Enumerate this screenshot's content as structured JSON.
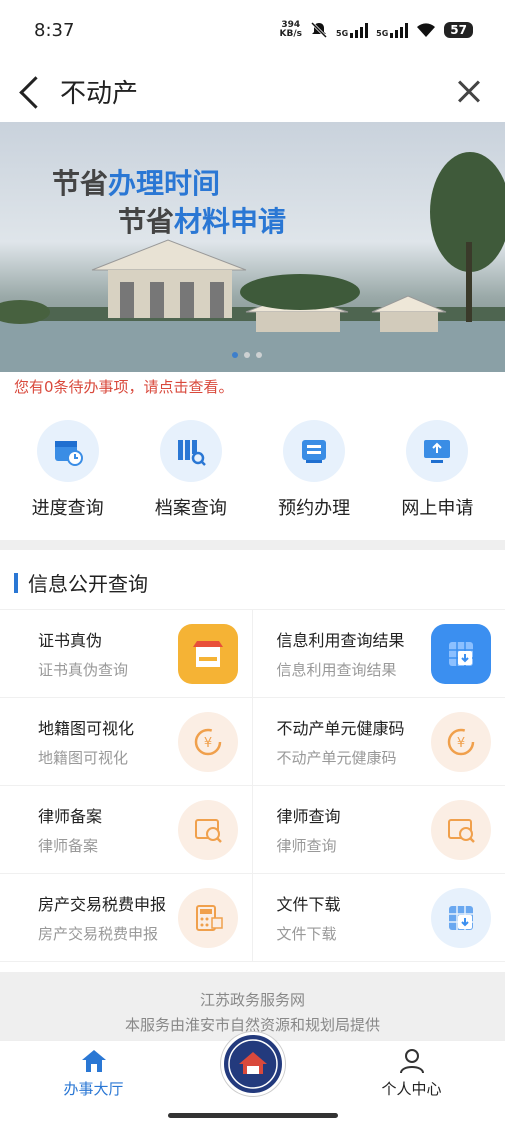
{
  "status": {
    "time": "8:37",
    "net_speed_top": "394",
    "net_speed_unit": "KB/s",
    "battery": "57",
    "sig1": "5G",
    "sig2": "5G"
  },
  "nav": {
    "title": "不动产"
  },
  "banner": {
    "line1_a": "节省",
    "line1_b": "办理时间",
    "line2_a": "节省",
    "line2_b": "材料申请"
  },
  "notice": "您有0条待办事项，请点击查看。",
  "quick": [
    {
      "label": "进度查询",
      "icon": "calendar-clock-icon"
    },
    {
      "label": "档案查询",
      "icon": "archive-search-icon"
    },
    {
      "label": "预约办理",
      "icon": "printer-ticket-icon"
    },
    {
      "label": "网上申请",
      "icon": "computer-upload-icon"
    }
  ],
  "section": {
    "title": "信息公开查询"
  },
  "items": [
    {
      "title": "证书真伪",
      "subtitle": "证书真伪查询",
      "icon": "shop-icon"
    },
    {
      "title": "信息利用查询结果",
      "subtitle": "信息利用查询结果",
      "icon": "table-download-icon"
    },
    {
      "title": "地籍图可视化",
      "subtitle": "地籍图可视化",
      "icon": "yen-cycle-icon"
    },
    {
      "title": "不动产单元健康码",
      "subtitle": "不动产单元健康码",
      "icon": "yen-cycle-icon"
    },
    {
      "title": "律师备案",
      "subtitle": "律师备案",
      "icon": "ems-search-icon"
    },
    {
      "title": "律师查询",
      "subtitle": "律师查询",
      "icon": "ems-search-icon"
    },
    {
      "title": "房产交易税费申报",
      "subtitle": "房产交易税费申报",
      "icon": "tax-calculator-icon"
    },
    {
      "title": "文件下载",
      "subtitle": "文件下载",
      "icon": "table-download-icon"
    }
  ],
  "footer": {
    "line1": "江苏政务服务网",
    "line2": "本服务由淮安市自然资源和规划局提供"
  },
  "tabs": {
    "left": "办事大厅",
    "right": "个人中心"
  },
  "colors": {
    "accent": "#2a77d4",
    "notice": "#d9493c",
    "icon_bg_orange": "#fbeee4",
    "icon_bg_blue": "#e7f1fc"
  }
}
